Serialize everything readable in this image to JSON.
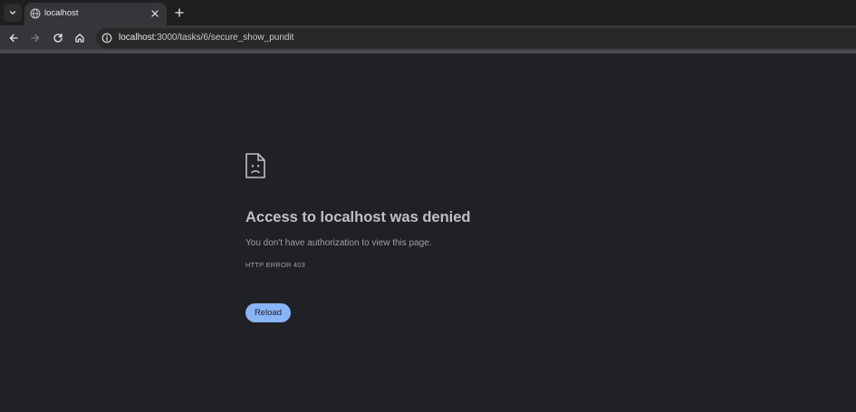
{
  "tab": {
    "title": "localhost",
    "favicon": "globe-icon"
  },
  "address_bar": {
    "host": "localhost",
    "path": ":3000/tasks/6/secure_show_pundit"
  },
  "error": {
    "title": "Access to localhost was denied",
    "description": "You don't have authorization to view this page.",
    "code": "HTTP ERROR 403",
    "reload_label": "Reload"
  },
  "colors": {
    "background": "#202124",
    "button": "#8ab4f8"
  }
}
